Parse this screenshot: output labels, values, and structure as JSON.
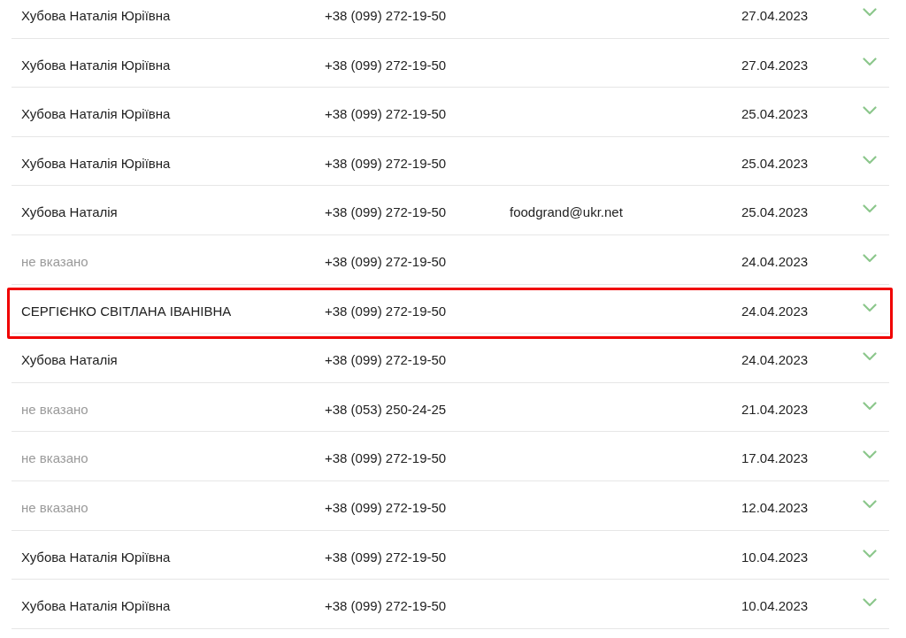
{
  "rows": [
    {
      "name": "Хубова Наталія Юріївна",
      "name_missing": false,
      "phone": "+38 (099) 272-19-50",
      "date": "27.04.2023",
      "highlighted": false
    },
    {
      "name": "Хубова Наталія Юріївна",
      "name_missing": false,
      "phone": "+38 (099) 272-19-50",
      "date": "27.04.2023",
      "highlighted": false
    },
    {
      "name": "Хубова Наталія Юріївна",
      "name_missing": false,
      "phone": "+38 (099) 272-19-50",
      "date": "25.04.2023",
      "highlighted": false
    },
    {
      "name": "Хубова Наталія Юріївна",
      "name_missing": false,
      "phone": "+38 (099) 272-19-50",
      "date": "25.04.2023",
      "highlighted": false
    },
    {
      "name": "Хубова Наталія",
      "name_missing": false,
      "phone": "+38 (099) 272-19-50",
      "email": "foodgrand@ukr.net",
      "date": "25.04.2023",
      "highlighted": false
    },
    {
      "name": "не вказано",
      "name_missing": true,
      "phone": "+38 (099) 272-19-50",
      "date": "24.04.2023",
      "highlighted": false
    },
    {
      "name": "СЕРГІЄНКО СВІТЛАНА ІВАНІВНА",
      "name_missing": false,
      "phone": "+38 (099) 272-19-50",
      "date": "24.04.2023",
      "highlighted": true
    },
    {
      "name": "Хубова Наталія",
      "name_missing": false,
      "phone": "+38 (099) 272-19-50",
      "date": "24.04.2023",
      "highlighted": false
    },
    {
      "name": "не вказано",
      "name_missing": true,
      "phone": "+38 (053) 250-24-25",
      "date": "21.04.2023",
      "highlighted": false
    },
    {
      "name": "не вказано",
      "name_missing": true,
      "phone": "+38 (099) 272-19-50",
      "date": "17.04.2023",
      "highlighted": false
    },
    {
      "name": "не вказано",
      "name_missing": true,
      "phone": "+38 (099) 272-19-50",
      "date": "12.04.2023",
      "highlighted": false
    },
    {
      "name": "Хубова Наталія Юріївна",
      "name_missing": false,
      "phone": "+38 (099) 272-19-50",
      "date": "10.04.2023",
      "highlighted": false
    },
    {
      "name": "Хубова Наталія Юріївна",
      "name_missing": false,
      "phone": "+38 (099) 272-19-50",
      "date": "10.04.2023",
      "highlighted": false
    }
  ]
}
